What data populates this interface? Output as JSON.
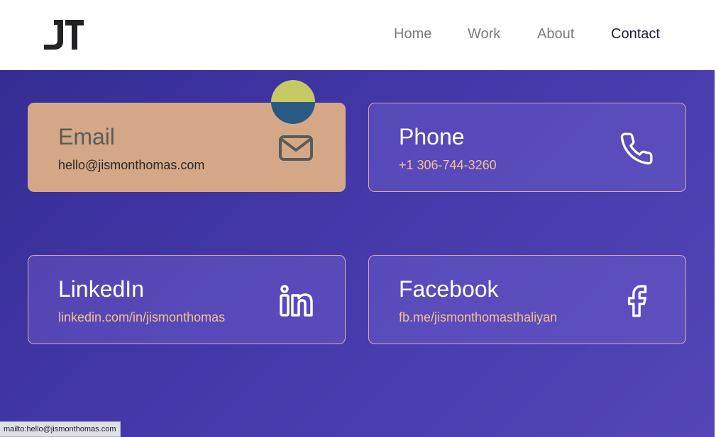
{
  "header": {
    "logo_text": "JT",
    "nav": [
      {
        "label": "Home",
        "active": false
      },
      {
        "label": "Work",
        "active": false
      },
      {
        "label": "About",
        "active": false
      },
      {
        "label": "Contact",
        "active": true
      }
    ]
  },
  "contacts": [
    {
      "title": "Email",
      "value": "hello@jismonthomas.com",
      "icon": "mail-icon",
      "hovered": true
    },
    {
      "title": "Phone",
      "value": "+1 306-744-3260",
      "icon": "phone-icon",
      "hovered": false
    },
    {
      "title": "LinkedIn",
      "value": "linkedin.com/in/jismonthomas",
      "icon": "linkedin-icon",
      "hovered": false
    },
    {
      "title": "Facebook",
      "value": "fb.me/jismonthomasthaliyan",
      "icon": "facebook-icon",
      "hovered": false
    }
  ],
  "status_bar": {
    "text": "mailto:hello@jismonthomas.com"
  },
  "colors": {
    "accent": "#f7c08e",
    "hover_card": "#d4a886",
    "gradient_start": "#352c93",
    "gradient_end": "#5446b6"
  }
}
